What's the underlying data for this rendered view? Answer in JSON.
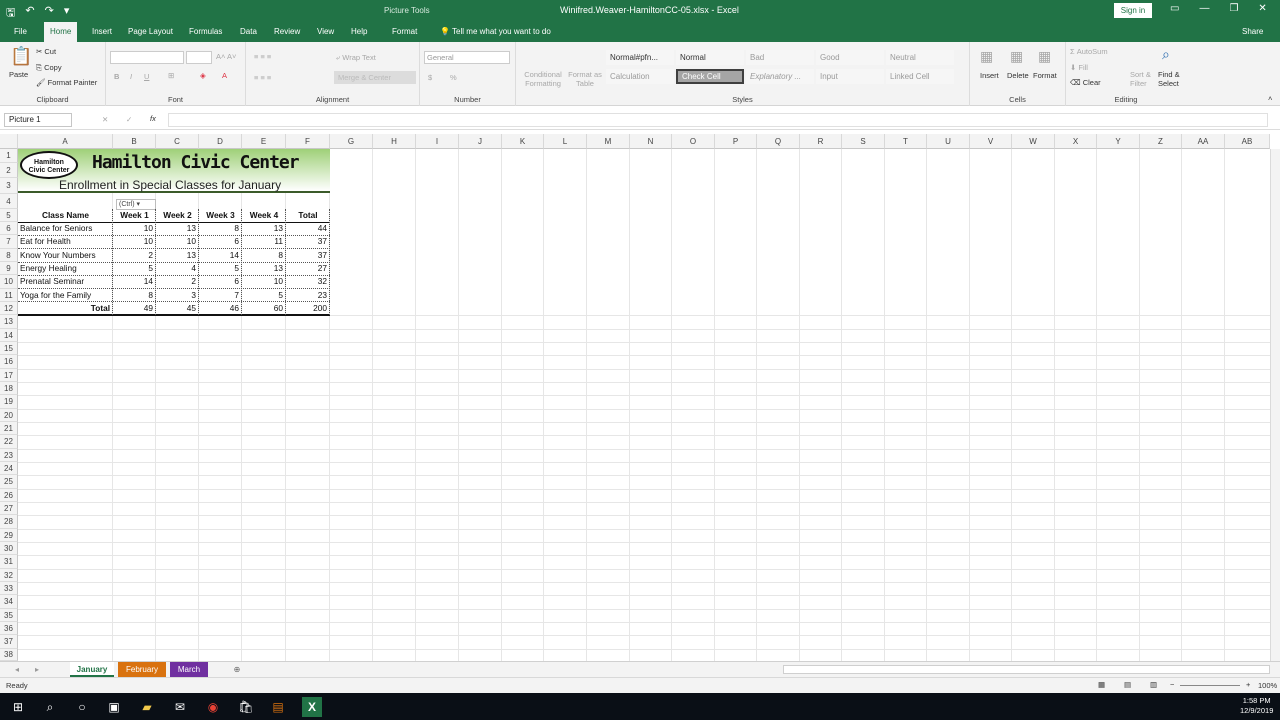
{
  "titlebar": {
    "context_title": "Picture Tools",
    "doc_title": "Winifred.Weaver-HamiltonCC-05.xlsx  -  Excel",
    "signin": "Sign in"
  },
  "tabs": [
    "File",
    "Home",
    "Insert",
    "Page Layout",
    "Formulas",
    "Data",
    "Review",
    "View",
    "Help",
    "Format"
  ],
  "tellme": "Tell me what you want to do",
  "share": "Share",
  "ribbon": {
    "clipboard": {
      "paste": "Paste",
      "cut": "Cut",
      "copy": "Copy",
      "format_painter": "Format Painter",
      "label": "Clipboard"
    },
    "font": {
      "label": "Font",
      "bold": "B",
      "italic": "I",
      "underline": "U"
    },
    "alignment": {
      "wrap_text": "Wrap Text",
      "merge": "Merge & Center",
      "label": "Alignment"
    },
    "number": {
      "format": "General",
      "currency": "$",
      "percent": "%",
      "label": "Number"
    },
    "styles": {
      "conditional": "Conditional Formatting",
      "format_as_table": "Format as Table",
      "cells": [
        "Normal#pfn...",
        "Normal",
        "Bad",
        "Good",
        "Neutral",
        "Calculation",
        "Check Cell",
        "Explanatory ...",
        "Input",
        "Linked Cell"
      ],
      "label": "Styles"
    },
    "cells": {
      "insert": "Insert",
      "delete": "Delete",
      "format": "Format",
      "label": "Cells"
    },
    "editing": {
      "autosum": "AutoSum",
      "fill": "Fill",
      "clear": "Clear",
      "sort_filter": "Sort & Filter",
      "find_select": "Find & Select",
      "label": "Editing"
    }
  },
  "namebox": "Picture 1",
  "fx": "fx",
  "columns": [
    "A",
    "B",
    "C",
    "D",
    "E",
    "F",
    "G",
    "H",
    "I",
    "J",
    "K",
    "L",
    "M",
    "N",
    "O",
    "P",
    "Q",
    "R",
    "S",
    "T",
    "U",
    "V",
    "W",
    "X",
    "Y",
    "Z",
    "AA",
    "AB"
  ],
  "rows": [
    "1",
    "2",
    "3",
    "4",
    "5",
    "6",
    "7",
    "8",
    "9",
    "10",
    "11",
    "12",
    "13",
    "14",
    "15",
    "16",
    "17",
    "18",
    "19",
    "20",
    "21",
    "22",
    "23",
    "24",
    "25",
    "26",
    "27",
    "28",
    "29",
    "30",
    "31",
    "32",
    "33",
    "34",
    "35",
    "36",
    "37",
    "38"
  ],
  "sheet": {
    "title": "Hamilton Civic Center",
    "subtitle": "Enrollment in Special Classes for January",
    "logo_text": "Hamilton Civic Center",
    "ctrl_tag": "(Ctrl) ▾",
    "headers": [
      "Class Name",
      "Week 1",
      "Week 2",
      "Week 3",
      "Week 4",
      "Total"
    ],
    "data_rows": [
      {
        "name": "Balance for Seniors",
        "w1": "10",
        "w2": "13",
        "w3": "8",
        "w4": "13",
        "total": "44"
      },
      {
        "name": "Eat for Health",
        "w1": "10",
        "w2": "10",
        "w3": "6",
        "w4": "11",
        "total": "37"
      },
      {
        "name": "Know Your Numbers",
        "w1": "2",
        "w2": "13",
        "w3": "14",
        "w4": "8",
        "total": "37"
      },
      {
        "name": "Energy Healing",
        "w1": "5",
        "w2": "4",
        "w3": "5",
        "w4": "13",
        "total": "27"
      },
      {
        "name": "Prenatal Seminar",
        "w1": "14",
        "w2": "2",
        "w3": "6",
        "w4": "10",
        "total": "32"
      },
      {
        "name": "Yoga for the Family",
        "w1": "8",
        "w2": "3",
        "w3": "7",
        "w4": "5",
        "total": "23"
      }
    ],
    "total_row": {
      "name": "Total",
      "w1": "49",
      "w2": "45",
      "w3": "46",
      "w4": "60",
      "total": "200"
    }
  },
  "sheet_tabs": [
    {
      "label": "January",
      "color": "#ffffff"
    },
    {
      "label": "February",
      "color": "#d9720f"
    },
    {
      "label": "March",
      "color": "#7030a0"
    }
  ],
  "status": {
    "ready": "Ready",
    "zoom": "100%"
  },
  "clock": {
    "time": "1:58 PM",
    "date": "12/9/2019"
  }
}
